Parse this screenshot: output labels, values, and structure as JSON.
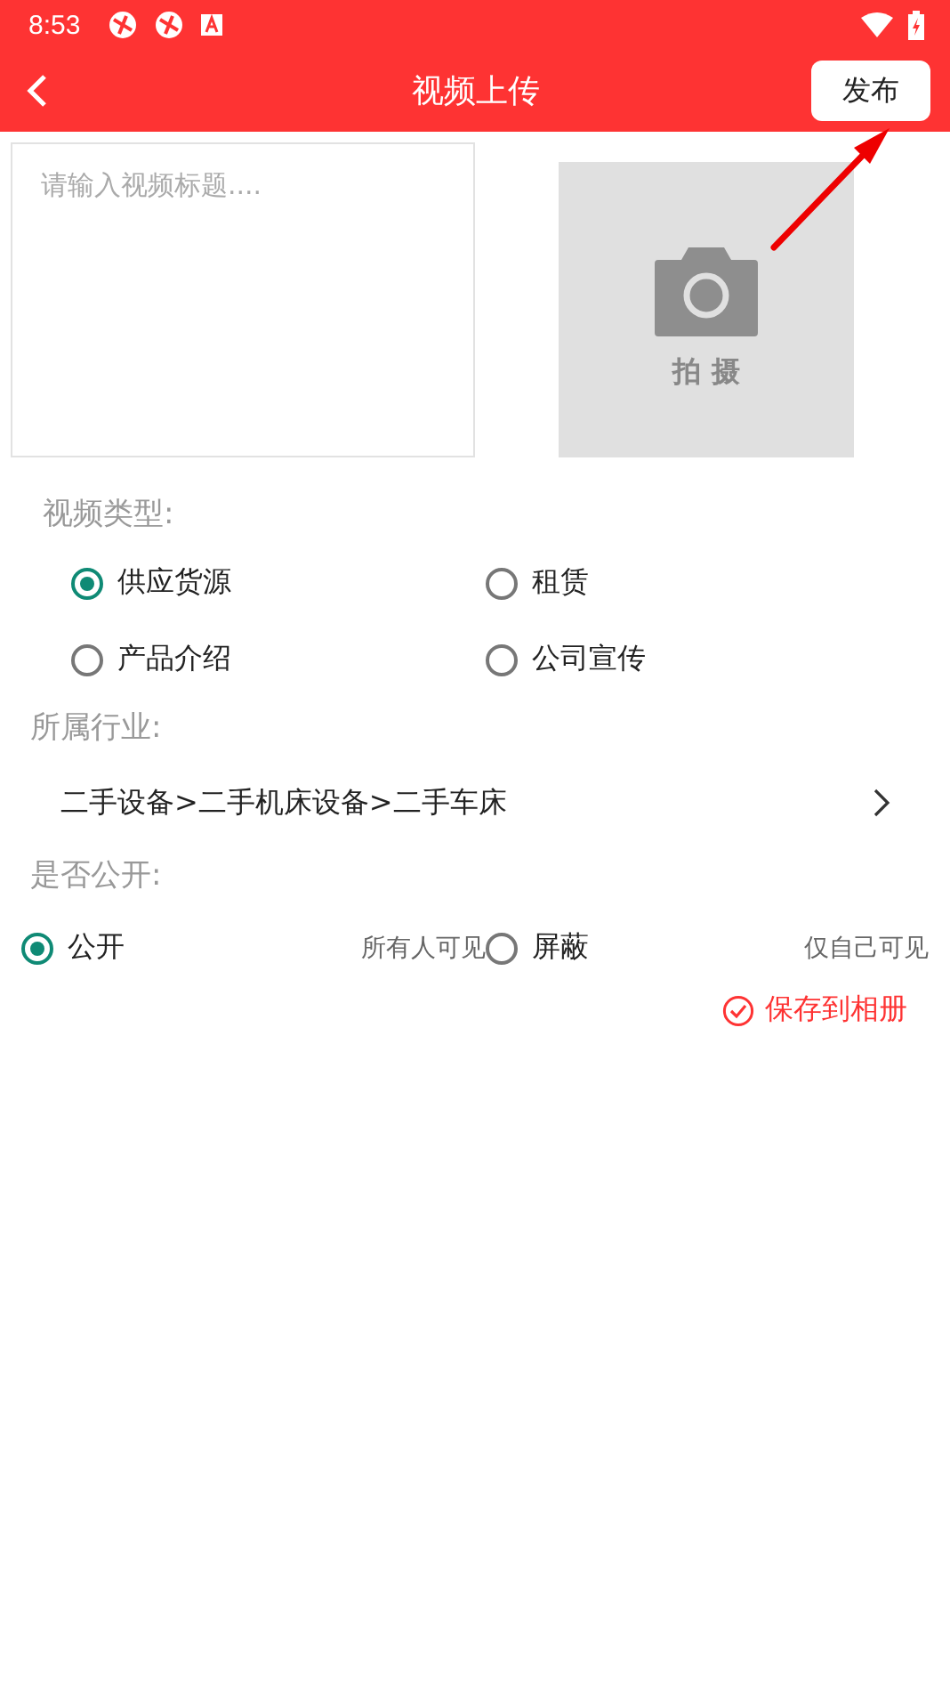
{
  "status_bar": {
    "time": "8:53"
  },
  "app_bar": {
    "title": "视频上传",
    "publish_button": "发布"
  },
  "title_field": {
    "placeholder": "请输入视频标题...."
  },
  "capture": {
    "label": "拍 摄"
  },
  "video_type": {
    "label": "视频类型:",
    "options": [
      {
        "label": "供应货源",
        "selected": true
      },
      {
        "label": "租赁",
        "selected": false
      },
      {
        "label": "产品介绍",
        "selected": false
      },
      {
        "label": "公司宣传",
        "selected": false
      }
    ]
  },
  "industry": {
    "label": "所属行业:",
    "value": "二手设备>二手机床设备>二手车床"
  },
  "visibility": {
    "label": "是否公开:",
    "options": [
      {
        "label": "公开",
        "hint": "所有人可见",
        "selected": true
      },
      {
        "label": "屏蔽",
        "hint": "仅自己可见",
        "selected": false
      }
    ]
  },
  "save_to_album": {
    "label": "保存到相册",
    "checked": true
  }
}
